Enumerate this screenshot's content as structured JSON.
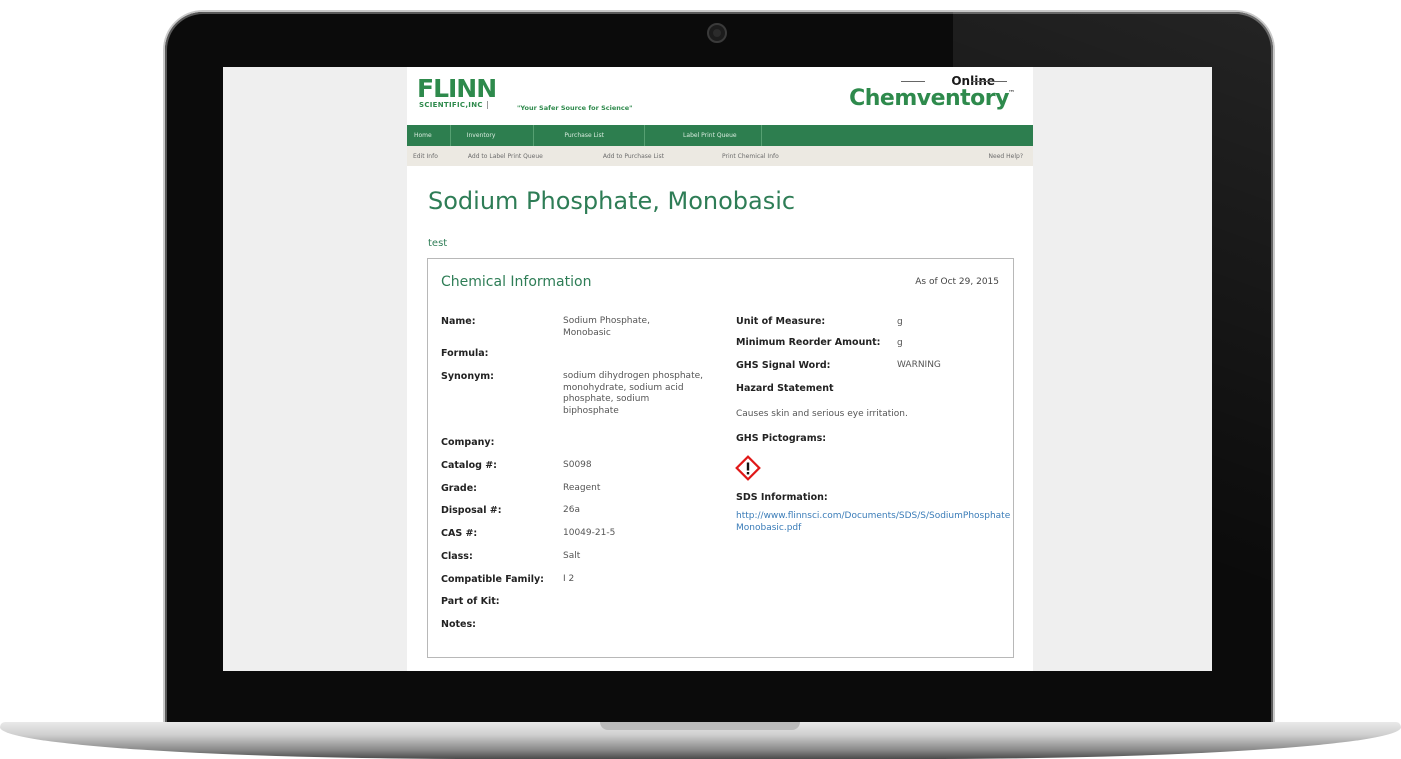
{
  "brand": {
    "flinn": "FLINN",
    "scientific": "SCIENTIFIC,INC",
    "tagline": "\"Your Safer Source for Science\"",
    "online": "Online",
    "chemventory": "Chemventory",
    "tm": "™",
    "green": "#2e8a4c"
  },
  "main_nav": [
    "Home",
    "Inventory",
    "Purchase List",
    "Label Print Queue"
  ],
  "sub_nav": [
    "Edit Info",
    "Add to Label Print Queue",
    "Add to Purchase List",
    "Print Chemical Info"
  ],
  "help_link": "Need Help?",
  "page": {
    "title": "Sodium Phosphate, Monobasic",
    "subtitle": "test"
  },
  "info": {
    "title": "Chemical Information",
    "as_of": "As of Oct 29, 2015",
    "left": [
      {
        "label": "Name:",
        "value": "Sodium Phosphate, Monobasic"
      },
      {
        "label": "Formula:",
        "value": ""
      },
      {
        "label": "Synonym:",
        "value": "sodium dihydrogen phosphate, monohydrate, sodium acid phosphate, sodium biphosphate"
      },
      {
        "label": "Company:",
        "value": ""
      },
      {
        "label": "Catalog #:",
        "value": "S0098"
      },
      {
        "label": "Grade:",
        "value": "Reagent"
      },
      {
        "label": "Disposal #:",
        "value": "26a"
      },
      {
        "label": "CAS #:",
        "value": "10049-21-5"
      },
      {
        "label": "Class:",
        "value": "Salt"
      },
      {
        "label": "Compatible Family:",
        "value": "I 2"
      },
      {
        "label": "Part of Kit:",
        "value": ""
      },
      {
        "label": "Notes:",
        "value": ""
      }
    ],
    "right": {
      "unit_label": "Unit of Measure:",
      "unit_value": "g",
      "reorder_label": "Minimum Reorder Amount:",
      "reorder_value": "g",
      "signal_label": "GHS Signal Word:",
      "signal_value": "WARNING",
      "hazard_label": "Hazard Statement",
      "hazard_value": "Causes skin and serious eye irritation.",
      "pictograms_label": "GHS Pictograms:",
      "pictogram_icon": "exclamation-mark-icon",
      "pictogram_color": "#e01818",
      "sds_label": "SDS Information:",
      "sds_link": "http://www.flinnsci.com/Documents/SDS/S/SodiumPhosphateMonobasic.pdf"
    }
  }
}
